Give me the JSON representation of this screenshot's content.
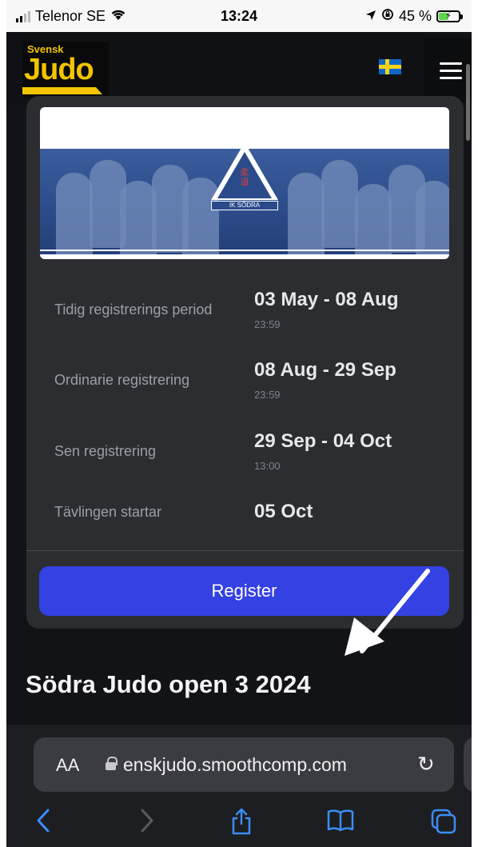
{
  "status_bar": {
    "carrier": "Telenor SE",
    "time": "13:24",
    "battery_label": "45 %",
    "battery_level": 0.45
  },
  "header": {
    "logo_top": "Svensk",
    "logo_main": "Judo"
  },
  "banner": {
    "kanji": "柔\n道",
    "club": "IK SÖDRA"
  },
  "registration": [
    {
      "label": "Tidig registrerings period",
      "range": "03 May - 08 Aug",
      "time": "23:59"
    },
    {
      "label": "Ordinarie registrering",
      "range": "08 Aug - 29 Sep",
      "time": "23:59"
    },
    {
      "label": "Sen registrering",
      "range": "29 Sep - 04 Oct",
      "time": "13:00"
    },
    {
      "label": "Tävlingen startar",
      "range": "05 Oct",
      "time": ""
    }
  ],
  "register_button": "Register",
  "event_title": "Södra Judo open 3 2024",
  "safari": {
    "aa": "AA",
    "url": "enskjudo.smoothcomp.com"
  },
  "colors": {
    "accent": "#3441e3",
    "logo": "#f2c400",
    "link": "#3a8ef7"
  }
}
